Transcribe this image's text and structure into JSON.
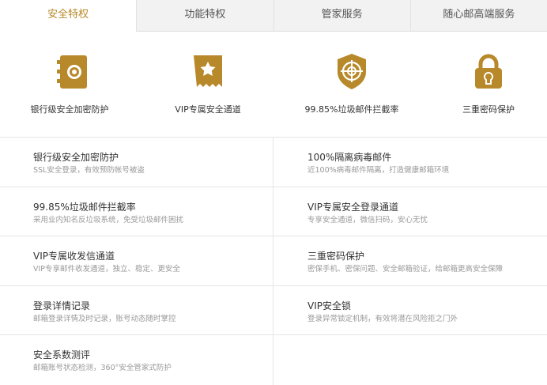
{
  "tabs": [
    "安全特权",
    "功能特权",
    "管家服务",
    "随心邮高端服务"
  ],
  "accent": "#b8892a",
  "features": [
    {
      "icon": "safe-icon",
      "label": "银行级安全加密防护"
    },
    {
      "icon": "vip-ticket-icon",
      "label": "VIP专属安全通道"
    },
    {
      "icon": "shield-target-icon",
      "label": "99.85%垃圾邮件拦截率"
    },
    {
      "icon": "lock-icon",
      "label": "三重密码保护"
    }
  ],
  "items": [
    {
      "title": "银行级安全加密防护",
      "desc": "SSL安全登录，有效预防帐号被盗"
    },
    {
      "title": "100%隔离病毒邮件",
      "desc": "近100%病毒邮件隔离，打造健康邮箱环境"
    },
    {
      "title": "99.85%垃圾邮件拦截率",
      "desc": "采用业内知名反垃圾系统，免受垃圾邮件困扰"
    },
    {
      "title": "VIP专属安全登录通道",
      "desc": "专享安全通道，微信扫码，安心无忧"
    },
    {
      "title": "VIP专属收发信通道",
      "desc": "VIP专享邮件收发通道，独立、稳定、更安全"
    },
    {
      "title": "三重密码保护",
      "desc": "密保手机、密保问题、安全邮箱验证，给邮箱更高安全保障"
    },
    {
      "title": "登录详情记录",
      "desc": "邮箱登录详情及时记录，账号动态随时掌控"
    },
    {
      "title": "VIP安全锁",
      "desc": "登录异常锁定机制，有效将潜在风险拒之门外"
    },
    {
      "title": "安全系数测评",
      "desc": "邮箱账号状态检测，360°安全管家式防护"
    }
  ]
}
